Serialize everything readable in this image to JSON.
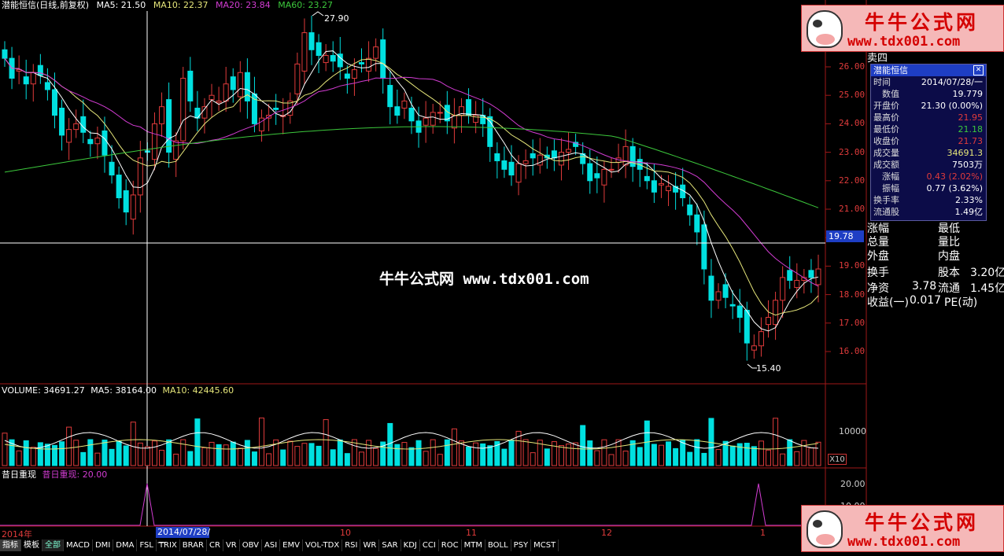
{
  "header": {
    "stock": "潜能恒信(日线,前复权)",
    "ma5": "MA5: 21.50",
    "ma10": "MA10: 22.37",
    "ma20": "MA20: 23.84",
    "ma60": "MA60: 23.27"
  },
  "colors": {
    "ma5": "#ffffff",
    "ma10": "#e6e67a",
    "ma20": "#d23cd2",
    "ma60": "#3cc83c",
    "up": "#e03b3b",
    "down": "#00e0e0",
    "axis": "#a01818"
  },
  "price_axis": [
    "26.00",
    "25.00",
    "24.00",
    "23.00",
    "22.00",
    "21.00",
    "19.00",
    "18.00",
    "17.00",
    "16.00"
  ],
  "crosshair_value": "19.78",
  "peak_high": "27.90",
  "peak_low": "15.40",
  "volume": {
    "label": "VOLUME: 34691.27",
    "ma5": "MA5: 38164.00",
    "ma10": "MA10: 42445.60",
    "axis_value": "10000",
    "unit_tag": "X10"
  },
  "indicator3": {
    "name": "昔日重现",
    "value": "昔日重现: 20.00",
    "axis_values": [
      "20.00",
      "10.00"
    ]
  },
  "x_axis": {
    "year": "2014年",
    "selected": "2014/07/28/一",
    "months": [
      "10",
      "11",
      "12",
      "1"
    ]
  },
  "tabs": [
    "指标",
    "模板",
    "全部",
    "MACD",
    "DMI",
    "DMA",
    "FSL",
    "TRIX",
    "BRAR",
    "CR",
    "VR",
    "OBV",
    "ASI",
    "EMV",
    "VOL-TDX",
    "RSI",
    "WR",
    "SAR",
    "KDJ",
    "CCI",
    "ROC",
    "MTM",
    "BOLL",
    "PSY",
    "MCST"
  ],
  "watermark": {
    "title": "牛牛公式网",
    "url": "www.tdx001.com",
    "center": "牛牛公式网 www.tdx001.com"
  },
  "side_top": "卖四",
  "info_panel": {
    "title": "潜能恒信",
    "rows": [
      {
        "k": "时间",
        "v": "2014/07/28/一",
        "c": "#ffffff"
      },
      {
        "k": "数值",
        "v": "19.779",
        "c": "#ffffff"
      },
      {
        "k": "开盘价",
        "v": "21.30 (0.00%)",
        "c": "#ffffff"
      },
      {
        "k": "最高价",
        "v": "21.95",
        "c": "#e03b3b"
      },
      {
        "k": "最低价",
        "v": "21.18",
        "c": "#3cc83c"
      },
      {
        "k": "收盘价",
        "v": "21.73",
        "c": "#e03b3b"
      },
      {
        "k": "成交量",
        "v": "34691.3",
        "c": "#e6e67a"
      },
      {
        "k": "成交额",
        "v": "7503万",
        "c": "#ffffff"
      },
      {
        "k": "涨幅",
        "v": "0.43 (2.02%)",
        "c": "#e03b3b"
      },
      {
        "k": "振幅",
        "v": "0.77 (3.62%)",
        "c": "#ffffff"
      },
      {
        "k": "换手率",
        "v": "2.33%",
        "c": "#ffffff"
      },
      {
        "k": "流通股",
        "v": "1.49亿",
        "c": "#ffffff"
      }
    ]
  },
  "side_info": {
    "r1": {
      "a": "涨幅",
      "b": "最低"
    },
    "r2": {
      "a": "总量",
      "b": "量比"
    },
    "r3": {
      "a": "外盘",
      "b": "内盘"
    },
    "r4": {
      "a": "换手",
      "b": "股本",
      "bv": "3.20亿"
    },
    "r5": {
      "a": "净资",
      "av": "3.78",
      "b": "流通",
      "bv": "1.45亿"
    },
    "r6": {
      "a": "收益(一)",
      "av": "0.017",
      "b": "PE(动)"
    }
  }
}
